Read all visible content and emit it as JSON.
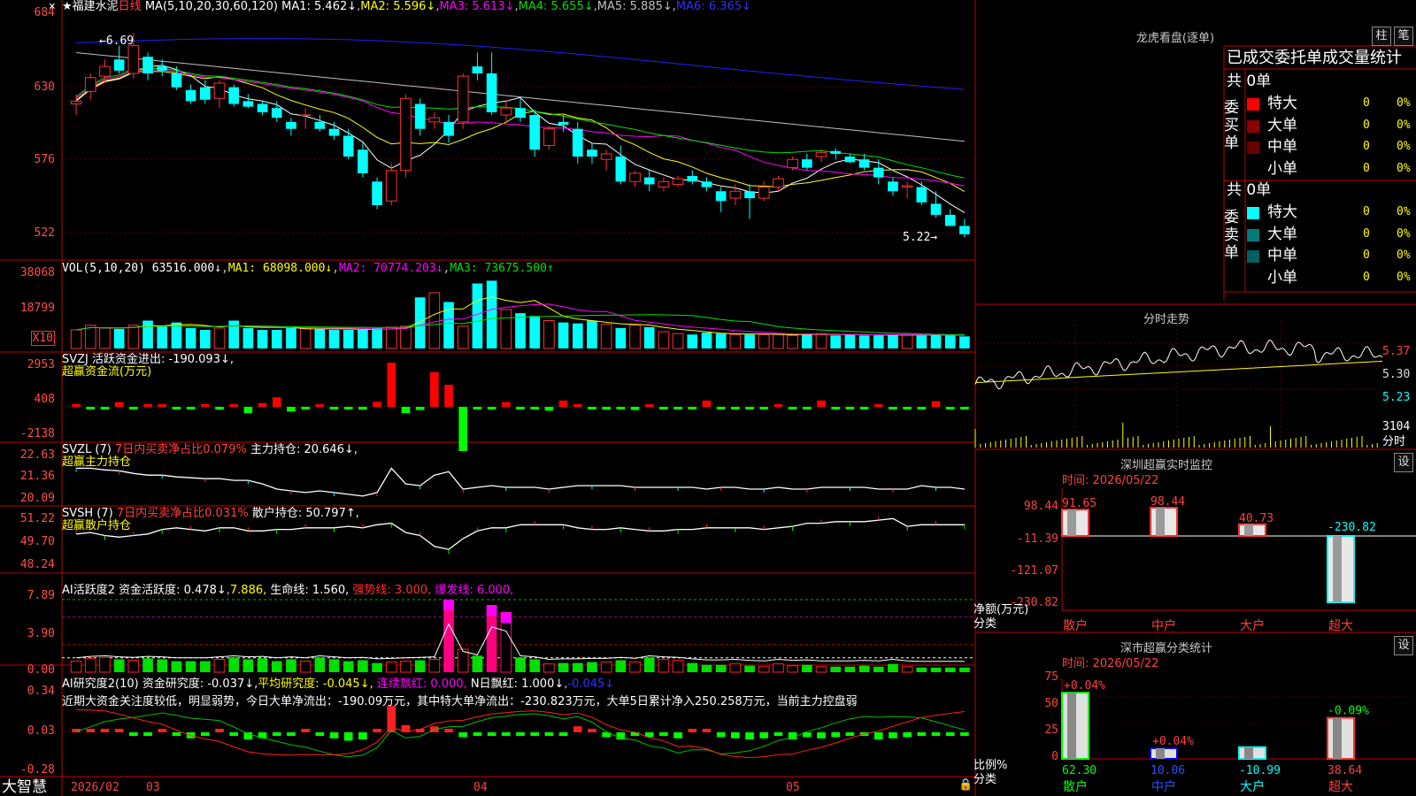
{
  "app": {
    "brand": "大智慧",
    "close_x": "×"
  },
  "colors": {
    "up": "#ff3030",
    "down": "#00ffff",
    "ma1": "#ffffff",
    "ma2": "#ffff00",
    "ma3": "#ff00ff",
    "ma4": "#00e000",
    "ma5": "#c0c0c0",
    "ma6": "#2020ff",
    "grid": "#8b0000",
    "frame": "#c00000"
  },
  "header": {
    "star": "★",
    "name": "福建水泥",
    "period": "日线",
    "ma_params": "MA(5,10,20,30,60,120)",
    "ma1": "MA1: 5.462↓",
    "ma2": "MA2: 5.596↓",
    "ma3": "MA3: 5.613↓",
    "ma4": "MA4: 5.655↓",
    "ma5": "MA5: 5.885↓",
    "ma6": "MA6: 6.365↓"
  },
  "main_axis": [
    "684",
    "630",
    "576",
    "522"
  ],
  "annot_high": "←6.69",
  "annot_low": "5.22→",
  "vol": {
    "header": "VOL(5,10,20)",
    "value": "63516.000↓",
    "ma1": "MA1: 68098.000↓",
    "ma2": "MA2: 70774.203↓",
    "ma3": "MA3: 73675.500↑",
    "axis": [
      "38068",
      "18799"
    ],
    "unit": "X10"
  },
  "svzj": {
    "header": "SVZJ  活跃资金进出: -190.093↓,",
    "sub": "超赢资金流(万元)",
    "axis": [
      "2953",
      "408",
      "-2138"
    ]
  },
  "svzl": {
    "header": "SVZL (7) ",
    "note": "7日内买卖净占比0.079%",
    "hold": "主力持仓: 20.646↓,",
    "sub": "超赢主力持仓",
    "axis": [
      "22.63",
      "21.36",
      "20.09"
    ]
  },
  "svsh": {
    "header": "SVSH (7) ",
    "note": "7日内买卖净占比0.031%",
    "hold": "散户持仓: 50.797↑,",
    "sub": "超赢散户持仓",
    "axis": [
      "51.22",
      "49.70",
      "48.24"
    ]
  },
  "ai1": {
    "header": "AI活跃度2",
    "a": "资金活跃度: 0.478↓",
    "b": "7.886,",
    "c": "生命线: 1.560,",
    "d": "强势线: 3.000,",
    "e": "爆发线: 6.000,",
    "axis": [
      "7.89",
      "3.90",
      "0.00"
    ]
  },
  "ai2": {
    "header": "AI研究度2(10)",
    "a": "资金研究度: -0.037↓,",
    "b": "平均研究度: -0.045↓,",
    "c": "连续飘红: 0.000,",
    "d": "N日飘红: 1.000↓",
    "e": "-0.045↓",
    "axis": [
      "0.34",
      "0.03",
      "-0.28"
    ],
    "comment": "近期大资金关注度较低，明显弱势，今日大单净流出：-190.09万元，其中特大单净流出：-230.823万元，大单5日累计净入250.258万元，当前主力控盘弱"
  },
  "dates": [
    "2026/02",
    "03",
    "04",
    "05"
  ],
  "lhb": {
    "title": "龙虎看盘(逐单)",
    "btn1": "柱",
    "btn2": "笔",
    "tabs": "已成交委托单成交量统计",
    "buy": {
      "side": "委买单",
      "total": "共 0单",
      "rows": [
        {
          "k": "特大",
          "v": "0",
          "p": "0%"
        },
        {
          "k": "大单",
          "v": "0",
          "p": "0%"
        },
        {
          "k": "中单",
          "v": "0",
          "p": "0%"
        },
        {
          "k": "小单",
          "v": "0",
          "p": "0%"
        }
      ]
    },
    "sell": {
      "side": "委卖单",
      "total": "共 0单",
      "rows": [
        {
          "k": "特大",
          "v": "0",
          "p": "0%"
        },
        {
          "k": "大单",
          "v": "0",
          "p": "0%"
        },
        {
          "k": "中单",
          "v": "0",
          "p": "0%"
        },
        {
          "k": "小单",
          "v": "0",
          "p": "0%"
        }
      ]
    }
  },
  "fenshi": {
    "title": "分时走势",
    "axis": [
      "5.37",
      "5.30",
      "5.23"
    ],
    "vol": "3104",
    "vol_lbl": "分时"
  },
  "monitor": {
    "title": "深圳超赢实时监控",
    "btn": "设",
    "time": "时间: 2026/05/22",
    "axis": [
      "98.44",
      "-11.39",
      "-121.07",
      "-230.82"
    ],
    "ylabel": "净额(万元)",
    "ylabel2": "分类"
  },
  "classify": {
    "title": "深市超赢分类统计",
    "btn": "设",
    "time": "时间: 2026/05/22",
    "axis": [
      "75",
      "50",
      "25",
      "0"
    ],
    "ylabel": "比例%",
    "ylabel2": "分类"
  },
  "chart_data": [
    {
      "type": "candlestick",
      "title": "福建水泥 日线",
      "ylim": [
        5.1,
        6.9
      ],
      "ohlc": [
        [
          6.18,
          6.25,
          6.1,
          6.2
        ],
        [
          6.27,
          6.4,
          6.21,
          6.37
        ],
        [
          6.38,
          6.5,
          6.33,
          6.45
        ],
        [
          6.5,
          6.6,
          6.4,
          6.42
        ],
        [
          6.4,
          6.69,
          6.36,
          6.6
        ],
        [
          6.52,
          6.55,
          6.35,
          6.4
        ],
        [
          6.45,
          6.5,
          6.38,
          6.42
        ],
        [
          6.4,
          6.45,
          6.28,
          6.3
        ],
        [
          6.28,
          6.32,
          6.18,
          6.2
        ],
        [
          6.3,
          6.35,
          6.18,
          6.21
        ],
        [
          6.22,
          6.35,
          6.15,
          6.33
        ],
        [
          6.3,
          6.32,
          6.16,
          6.18
        ],
        [
          6.2,
          6.25,
          6.15,
          6.16
        ],
        [
          6.18,
          6.2,
          6.1,
          6.12
        ],
        [
          6.15,
          6.2,
          6.05,
          6.08
        ],
        [
          6.05,
          6.08,
          5.95,
          6.0
        ],
        [
          6.1,
          6.15,
          6.0,
          6.1
        ],
        [
          6.05,
          6.1,
          5.98,
          6.0
        ],
        [
          6.0,
          6.05,
          5.92,
          5.95
        ],
        [
          5.95,
          6.0,
          5.78,
          5.8
        ],
        [
          5.85,
          5.9,
          5.65,
          5.68
        ],
        [
          5.62,
          5.65,
          5.42,
          5.45
        ],
        [
          5.48,
          5.75,
          5.45,
          5.7
        ],
        [
          5.7,
          6.25,
          5.65,
          6.22
        ],
        [
          6.18,
          6.22,
          5.95,
          6.0
        ],
        [
          6.05,
          6.12,
          6.0,
          6.08
        ],
        [
          6.05,
          6.1,
          5.9,
          5.95
        ],
        [
          6.05,
          6.4,
          6.0,
          6.38
        ],
        [
          6.45,
          6.55,
          6.35,
          6.4
        ],
        [
          6.4,
          6.55,
          6.1,
          6.12
        ],
        [
          6.1,
          6.2,
          6.05,
          6.15
        ],
        [
          6.15,
          6.22,
          6.05,
          6.08
        ],
        [
          6.1,
          6.14,
          5.8,
          5.85
        ],
        [
          5.88,
          6.02,
          5.85,
          6.0
        ],
        [
          6.05,
          6.1,
          5.98,
          6.03
        ],
        [
          6.0,
          6.05,
          5.75,
          5.8
        ],
        [
          5.85,
          5.9,
          5.75,
          5.8
        ],
        [
          5.78,
          5.85,
          5.7,
          5.82
        ],
        [
          5.8,
          5.88,
          5.6,
          5.62
        ],
        [
          5.62,
          5.7,
          5.58,
          5.68
        ],
        [
          5.65,
          5.7,
          5.55,
          5.6
        ],
        [
          5.58,
          5.65,
          5.55,
          5.62
        ],
        [
          5.6,
          5.66,
          5.58,
          5.64
        ],
        [
          5.66,
          5.7,
          5.6,
          5.62
        ],
        [
          5.62,
          5.65,
          5.55,
          5.58
        ],
        [
          5.55,
          5.58,
          5.4,
          5.48
        ],
        [
          5.5,
          5.6,
          5.45,
          5.55
        ],
        [
          5.55,
          5.6,
          5.35,
          5.5
        ],
        [
          5.5,
          5.62,
          5.48,
          5.58
        ],
        [
          5.58,
          5.66,
          5.55,
          5.64
        ],
        [
          5.72,
          5.8,
          5.7,
          5.78
        ],
        [
          5.78,
          5.82,
          5.7,
          5.72
        ],
        [
          5.8,
          5.85,
          5.76,
          5.83
        ],
        [
          5.84,
          5.86,
          5.78,
          5.82
        ],
        [
          5.8,
          5.82,
          5.75,
          5.76
        ],
        [
          5.78,
          5.82,
          5.7,
          5.72
        ],
        [
          5.72,
          5.78,
          5.6,
          5.65
        ],
        [
          5.62,
          5.65,
          5.52,
          5.55
        ],
        [
          5.58,
          5.62,
          5.5,
          5.59
        ],
        [
          5.58,
          5.62,
          5.45,
          5.47
        ],
        [
          5.46,
          5.55,
          5.36,
          5.38
        ],
        [
          5.38,
          5.42,
          5.3,
          5.3
        ],
        [
          5.3,
          5.35,
          5.22,
          5.24
        ]
      ]
    },
    {
      "type": "bar",
      "title": "VOL",
      "values": [
        20,
        25,
        22,
        21,
        25,
        30,
        24,
        28,
        22,
        20,
        22,
        30,
        22,
        20,
        20,
        22,
        22,
        21,
        20,
        20,
        20,
        22,
        23,
        24,
        55,
        60,
        50,
        24,
        70,
        73,
        42,
        38,
        35,
        30,
        28,
        27,
        30,
        26,
        22,
        25,
        23,
        18,
        16,
        15,
        17,
        16,
        15,
        15,
        15,
        15,
        14,
        16,
        16,
        14,
        15,
        14,
        14,
        15,
        15,
        14,
        15,
        14,
        13,
        12
      ]
    },
    {
      "type": "bar",
      "title": "SVZJ",
      "values": [
        70,
        -50,
        -60,
        150,
        -80,
        50,
        60,
        -50,
        -60,
        40,
        -90,
        60,
        -200,
        120,
        300,
        -150,
        -60,
        50,
        -80,
        -80,
        -90,
        160,
        1400,
        -200,
        -100,
        1100,
        700,
        -1400,
        -70,
        -70,
        150,
        -60,
        -60,
        -120,
        200,
        60,
        -80,
        -90,
        -70,
        -100,
        60,
        -60,
        -80,
        -60,
        200,
        -60,
        -80,
        -80,
        -70,
        50,
        -60,
        -60,
        200,
        -60,
        -80,
        -70,
        50,
        -60,
        -80,
        -80,
        180,
        -70,
        -60,
        -80
      ]
    },
    {
      "type": "line",
      "title": "SVZL",
      "values": [
        21.9,
        21.9,
        21.8,
        21.75,
        21.6,
        21.5,
        21.5,
        21.4,
        21.35,
        21.3,
        21.3,
        21.2,
        21.2,
        21.0,
        20.7,
        20.6,
        20.5,
        20.6,
        20.5,
        20.4,
        20.3,
        20.5,
        21.9,
        21.0,
        20.9,
        21.5,
        21.7,
        20.7,
        20.8,
        20.9,
        20.8,
        20.8,
        20.8,
        20.7,
        20.8,
        20.9,
        20.9,
        20.9,
        20.9,
        20.8,
        20.8,
        20.8,
        20.8,
        20.8,
        20.7,
        20.8,
        20.8,
        20.7,
        20.7,
        20.8,
        20.7,
        20.7,
        20.8,
        20.8,
        20.8,
        20.8,
        20.7,
        20.7,
        20.7,
        20.9,
        20.8,
        20.8,
        20.7,
        20.65
      ]
    },
    {
      "type": "line",
      "title": "SVSH",
      "values": [
        50.2,
        50.3,
        50.1,
        50.0,
        50.1,
        50.2,
        50.5,
        50.6,
        50.5,
        50.4,
        50.6,
        50.6,
        50.4,
        50.4,
        50.5,
        50.5,
        50.6,
        50.6,
        50.6,
        50.7,
        50.6,
        50.8,
        50.9,
        50.3,
        50.1,
        49.4,
        49.2,
        49.9,
        50.4,
        50.6,
        50.6,
        50.8,
        50.8,
        50.8,
        50.8,
        50.6,
        50.5,
        50.5,
        50.6,
        50.5,
        50.4,
        50.4,
        50.5,
        50.5,
        50.6,
        50.6,
        50.6,
        50.6,
        50.5,
        50.6,
        50.7,
        50.9,
        50.9,
        51.0,
        51.0,
        51.0,
        51.1,
        51.2,
        50.7,
        50.8,
        50.8,
        50.8,
        50.8,
        50.8
      ]
    },
    {
      "type": "bar",
      "title": "AI活跃度2",
      "values": [
        1.2,
        1.5,
        1.6,
        1.4,
        1.3,
        1.5,
        1.4,
        1.2,
        1.2,
        1.2,
        1.4,
        1.6,
        1.4,
        1.5,
        1.2,
        1.4,
        1.2,
        1.6,
        1.4,
        1.2,
        1.3,
        1.0,
        1.1,
        1.2,
        1.3,
        1.4,
        7.9,
        2.5,
        1.8,
        7.3,
        6.5,
        1.6,
        1.4,
        0.9,
        1.0,
        1.0,
        1.1,
        1.1,
        1.3,
        1.1,
        1.6,
        1.4,
        1.3,
        1.0,
        0.8,
        0.8,
        0.9,
        0.7,
        0.6,
        0.9,
        0.7,
        0.8,
        0.6,
        0.6,
        0.6,
        0.7,
        0.6,
        0.9,
        0.6,
        0.5,
        0.5,
        0.5,
        0.5,
        0.5
      ]
    },
    {
      "type": "bar",
      "title": "AI研究度2",
      "values": [
        0.01,
        0.01,
        0.02,
        0.0,
        -0.02,
        -0.02,
        0.0,
        -0.03,
        -0.05,
        -0.03,
        0.0,
        -0.03,
        -0.06,
        -0.05,
        -0.03,
        -0.02,
        0.0,
        -0.02,
        -0.05,
        -0.07,
        -0.06,
        0.02,
        0.22,
        0.06,
        0.02,
        0.05,
        0.02,
        -0.04,
        -0.03,
        -0.02,
        -0.03,
        -0.02,
        -0.01,
        -0.02,
        -0.03,
        0.05,
        0.03,
        -0.04,
        -0.06,
        -0.02,
        -0.04,
        -0.02,
        -0.05,
        0.02,
        0.03,
        -0.04,
        -0.05,
        -0.06,
        -0.05,
        -0.03,
        -0.06,
        -0.04,
        -0.05,
        -0.04,
        -0.03,
        -0.03,
        -0.06,
        -0.05,
        -0.04,
        -0.02,
        -0.03,
        -0.03,
        -0.02,
        -0.02
      ]
    },
    {
      "type": "bar",
      "title": "深圳超赢实时监控",
      "categories": [
        "散户",
        "中户",
        "大户",
        "超大"
      ],
      "values": [
        91.65,
        98.44,
        40.73,
        -230.82
      ]
    },
    {
      "type": "bar",
      "title": "深市超赢分类统计",
      "categories": [
        "散户",
        "中户",
        "大户",
        "超大"
      ],
      "values": [
        62.3,
        10.06,
        -10.99,
        38.64
      ],
      "pct": [
        "+0.04%",
        "+0.04%",
        "",
        "-0.09%"
      ]
    }
  ]
}
